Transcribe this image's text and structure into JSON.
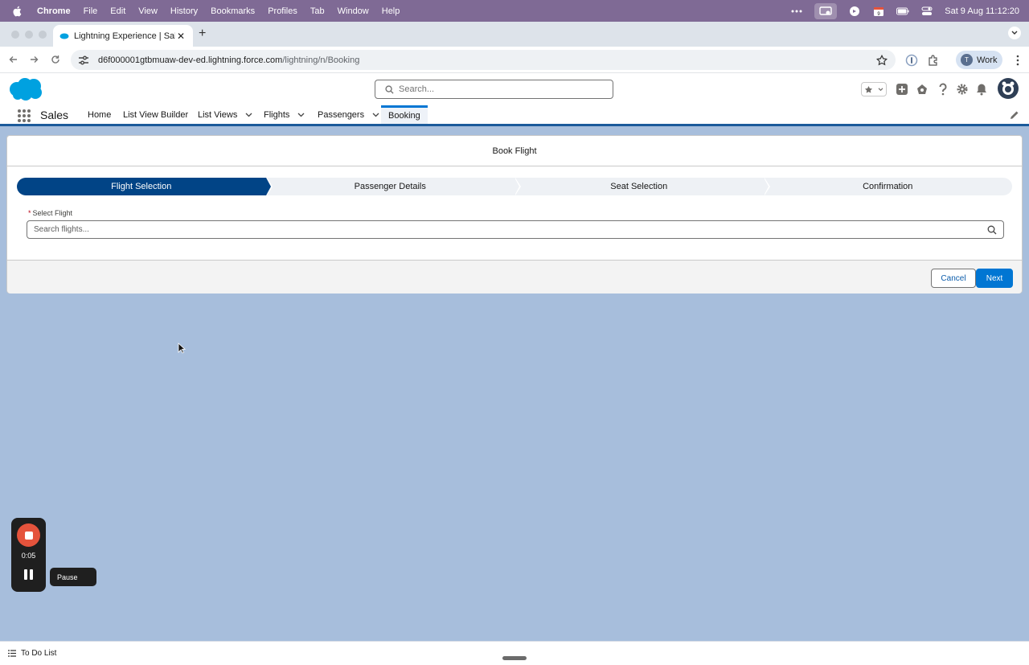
{
  "menubar": {
    "app": "Chrome",
    "items": [
      "File",
      "Edit",
      "View",
      "History",
      "Bookmarks",
      "Profiles",
      "Tab",
      "Window",
      "Help"
    ],
    "clock": "Sat 9 Aug  11:12:20",
    "calendar_day": "9"
  },
  "browser": {
    "tab_title": "Lightning Experience | Salesfo",
    "url_host": "d6f000001gtbmuaw-dev-ed.lightning.force.com",
    "url_path": "/lightning/n/Booking",
    "profile_initial": "T",
    "profile_label": "Work"
  },
  "sf": {
    "search_placeholder": "Search...",
    "app_name": "Sales",
    "nav": [
      {
        "label": "Home"
      },
      {
        "label": "List View Builder"
      },
      {
        "label": "List Views"
      },
      {
        "label": "Flights"
      },
      {
        "label": "Passengers"
      },
      {
        "label": "Booking"
      }
    ]
  },
  "booking": {
    "card_title": "Book Flight",
    "steps": [
      "Flight Selection",
      "Passenger Details",
      "Seat Selection",
      "Confirmation"
    ],
    "current_step": "Flight Selection",
    "field_required_mark": "*",
    "field_label": "Select Flight",
    "field_placeholder": "Search flights...",
    "cancel_label": "Cancel",
    "next_label": "Next"
  },
  "recorder": {
    "time": "0:05",
    "tooltip": "Pause"
  },
  "utility": {
    "todo_label": "To Do List"
  },
  "colors": {
    "menubar": "#7f6a95",
    "brand_blue": "#0176d3",
    "path_current": "#014486",
    "page_background": "#a7bedc",
    "recorder_stop": "#e5533c"
  }
}
